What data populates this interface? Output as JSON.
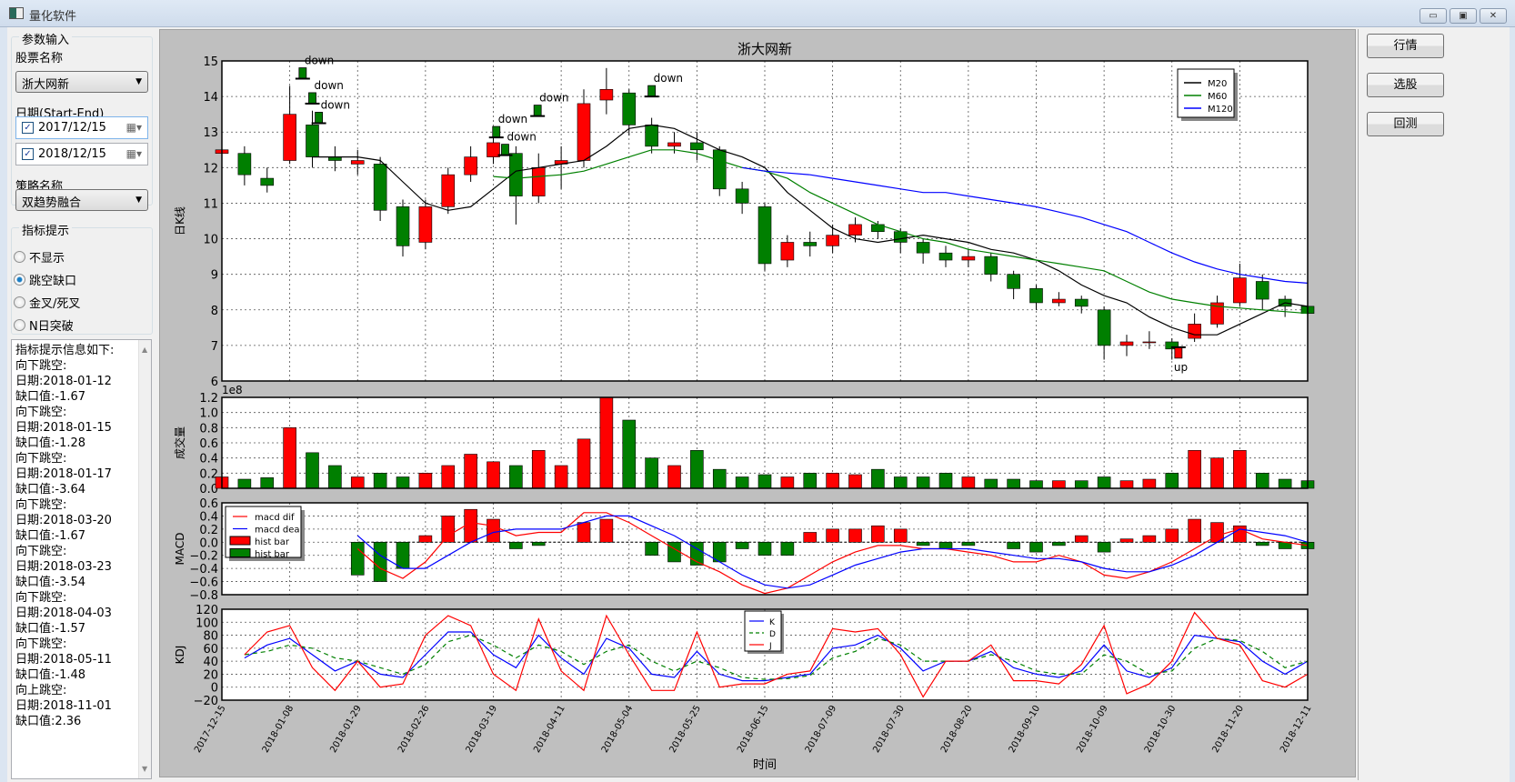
{
  "window": {
    "title": "量化软件",
    "minimize": "▭",
    "maximize": "▣",
    "close": "✕"
  },
  "left": {
    "params_group": "参数输入",
    "stock_label": "股票名称",
    "stock_value": "浙大网新",
    "date_label": "日期(Start-End)",
    "start_date": "2017/12/15",
    "end_date": "2018/12/15",
    "strategy_label": "策略名称",
    "strategy_value": "双趋势融合",
    "indicator_group": "指标提示",
    "radios": [
      {
        "label": "不显示",
        "checked": false
      },
      {
        "label": "跳空缺口",
        "checked": true
      },
      {
        "label": "金叉/死叉",
        "checked": false
      },
      {
        "label": "N日突破",
        "checked": false
      }
    ],
    "info_lines": [
      "指标提示信息如下:",
      "向下跳空:",
      "日期:2018-01-12",
      "缺口值:-1.67",
      "向下跳空:",
      "日期:2018-01-15",
      "缺口值:-1.28",
      "向下跳空:",
      "日期:2018-01-17",
      "缺口值:-3.64",
      "向下跳空:",
      "日期:2018-03-20",
      "缺口值:-1.67",
      "向下跳空:",
      "日期:2018-03-23",
      "缺口值:-3.54",
      "向下跳空:",
      "日期:2018-04-03",
      "缺口值:-1.57",
      "向下跳空:",
      "日期:2018-05-11",
      "缺口值:-1.48",
      "向上跳空:",
      "日期:2018-11-01",
      "缺口值:2.36"
    ]
  },
  "right": {
    "buttons": [
      "行情",
      "选股",
      "回测"
    ]
  },
  "colors": {
    "up": "#ff0000",
    "down": "#007f00",
    "m20": "#000000",
    "m60": "#008000",
    "m120": "#0000ff",
    "dif": "#ff0000",
    "dea": "#0000ff",
    "k": "#0000ff",
    "d": "#008000",
    "j": "#ff0000"
  },
  "chart_data": {
    "type": "candlestick",
    "title": "浙大网新",
    "xlabel": "时间",
    "x_ticks": [
      "2017-12-15",
      "2018-01-08",
      "2018-01-29",
      "2018-02-26",
      "2018-03-19",
      "2018-04-11",
      "2018-05-04",
      "2018-05-25",
      "2018-06-15",
      "2018-07-09",
      "2018-07-30",
      "2018-08-20",
      "2018-09-10",
      "2018-10-09",
      "2018-10-30",
      "2018-11-20",
      "2018-12-11"
    ],
    "dates": [
      "2017-12-15",
      "2017-12-23",
      "2018-01-02",
      "2018-01-08",
      "2018-01-15",
      "2018-01-22",
      "2018-01-29",
      "2018-02-07",
      "2018-02-16",
      "2018-02-26",
      "2018-03-05",
      "2018-03-12",
      "2018-03-19",
      "2018-03-27",
      "2018-04-03",
      "2018-04-11",
      "2018-04-18",
      "2018-04-26",
      "2018-05-04",
      "2018-05-11",
      "2018-05-18",
      "2018-05-25",
      "2018-06-01",
      "2018-06-08",
      "2018-06-15",
      "2018-06-23",
      "2018-07-01",
      "2018-07-09",
      "2018-07-16",
      "2018-07-23",
      "2018-07-30",
      "2018-08-06",
      "2018-08-13",
      "2018-08-20",
      "2018-08-27",
      "2018-09-03",
      "2018-09-10",
      "2018-09-19",
      "2018-09-29",
      "2018-10-09",
      "2018-10-16",
      "2018-10-23",
      "2018-10-30",
      "2018-11-06",
      "2018-11-13",
      "2018-11-20",
      "2018-11-27",
      "2018-12-04",
      "2018-12-11"
    ],
    "price": {
      "ylabel": "日K线",
      "ylim": [
        6,
        15
      ],
      "grid": true,
      "open": [
        12.4,
        12.4,
        11.7,
        12.2,
        13.2,
        12.3,
        12.1,
        12.1,
        10.9,
        9.9,
        10.9,
        11.8,
        12.3,
        12.4,
        11.2,
        12.1,
        12.2,
        13.9,
        14.1,
        13.2,
        12.6,
        12.7,
        12.5,
        11.4,
        10.9,
        9.4,
        9.9,
        9.8,
        10.1,
        10.4,
        10.2,
        9.9,
        9.6,
        9.4,
        9.5,
        9.0,
        8.6,
        8.2,
        8.3,
        8.0,
        7.0,
        7.1,
        7.1,
        7.2,
        7.6,
        8.2,
        8.8,
        8.3,
        8.1
      ],
      "close": [
        12.5,
        11.8,
        11.5,
        13.5,
        12.3,
        12.2,
        12.2,
        10.8,
        9.8,
        10.9,
        11.8,
        12.3,
        12.7,
        11.2,
        12.0,
        12.2,
        13.8,
        14.2,
        13.2,
        12.6,
        12.7,
        12.5,
        11.4,
        11.0,
        9.3,
        9.9,
        9.8,
        10.1,
        10.4,
        10.2,
        9.9,
        9.6,
        9.4,
        9.5,
        9.0,
        8.6,
        8.2,
        8.3,
        8.1,
        7.0,
        7.1,
        7.1,
        6.9,
        7.6,
        8.2,
        8.9,
        8.3,
        8.1,
        7.9
      ],
      "high": [
        12.8,
        12.6,
        12.0,
        14.3,
        13.6,
        12.6,
        12.5,
        12.3,
        11.1,
        11.1,
        12.0,
        12.6,
        13.0,
        12.6,
        12.4,
        12.6,
        14.2,
        14.8,
        14.2,
        13.4,
        13.0,
        13.0,
        12.6,
        11.6,
        11.0,
        10.1,
        10.2,
        10.4,
        10.6,
        10.5,
        10.3,
        10.0,
        9.8,
        9.7,
        9.6,
        9.1,
        8.7,
        8.5,
        8.4,
        8.1,
        7.3,
        7.4,
        7.2,
        7.9,
        8.4,
        9.3,
        9.0,
        8.4,
        8.2
      ],
      "low": [
        12.2,
        11.5,
        11.3,
        12.1,
        12.0,
        11.9,
        11.8,
        10.5,
        9.5,
        9.7,
        10.7,
        11.6,
        12.1,
        10.4,
        11.0,
        11.4,
        12.0,
        13.5,
        12.9,
        12.4,
        12.4,
        12.2,
        11.2,
        10.7,
        9.1,
        9.2,
        9.5,
        9.6,
        9.9,
        10.0,
        9.6,
        9.3,
        9.2,
        9.2,
        8.8,
        8.3,
        8.0,
        8.1,
        7.9,
        6.6,
        6.7,
        6.9,
        6.6,
        7.1,
        7.5,
        8.1,
        8.0,
        7.8,
        7.7
      ],
      "series": [
        {
          "name": "M20",
          "values": [
            null,
            null,
            null,
            null,
            12.3,
            12.3,
            12.3,
            12.2,
            11.6,
            11.0,
            10.8,
            10.9,
            11.4,
            11.9,
            12.0,
            12.1,
            12.2,
            12.6,
            13.1,
            13.2,
            13.1,
            12.8,
            12.5,
            12.3,
            12.0,
            11.3,
            10.8,
            10.3,
            10.0,
            9.9,
            10.0,
            10.1,
            10.0,
            9.9,
            9.7,
            9.6,
            9.4,
            9.1,
            8.7,
            8.4,
            8.2,
            7.8,
            7.5,
            7.3,
            7.3,
            7.6,
            7.9,
            8.2,
            8.1
          ]
        },
        {
          "name": "M60",
          "values": [
            null,
            null,
            null,
            null,
            null,
            null,
            null,
            null,
            null,
            null,
            null,
            null,
            11.75,
            11.7,
            11.75,
            11.8,
            11.9,
            12.1,
            12.3,
            12.5,
            12.5,
            12.4,
            12.2,
            12.0,
            11.9,
            11.7,
            11.3,
            11.0,
            10.7,
            10.4,
            10.2,
            10.0,
            9.9,
            9.7,
            9.6,
            9.5,
            9.4,
            9.3,
            9.2,
            9.1,
            8.8,
            8.5,
            8.3,
            8.2,
            8.1,
            8.05,
            8.0,
            7.95,
            7.9
          ]
        },
        {
          "name": "M120",
          "values": [
            null,
            null,
            null,
            null,
            null,
            null,
            null,
            null,
            null,
            null,
            null,
            null,
            null,
            null,
            null,
            null,
            null,
            null,
            null,
            null,
            null,
            null,
            null,
            12.0,
            11.9,
            11.85,
            11.8,
            11.7,
            11.6,
            11.5,
            11.4,
            11.3,
            11.3,
            11.2,
            11.1,
            11.0,
            10.9,
            10.75,
            10.6,
            10.4,
            10.2,
            9.9,
            9.6,
            9.35,
            9.15,
            9.0,
            8.9,
            8.8,
            8.75
          ]
        }
      ],
      "legend": "top-right",
      "annotations": [
        {
          "text": "down",
          "date": "2018-01-12",
          "y": 14.5
        },
        {
          "text": "down",
          "date": "2018-01-15",
          "y": 13.8
        },
        {
          "text": "down",
          "date": "2018-01-17",
          "y": 13.25
        },
        {
          "text": "down",
          "date": "2018-03-20",
          "y": 12.85
        },
        {
          "text": "down",
          "date": "2018-03-23",
          "y": 12.35
        },
        {
          "text": "down",
          "date": "2018-04-03",
          "y": 13.45
        },
        {
          "text": "down",
          "date": "2018-05-11",
          "y": 14.0
        },
        {
          "text": "up",
          "date": "2018-11-01",
          "y": 6.95
        }
      ]
    },
    "volume": {
      "ylabel": "成交量",
      "offset_text": "1e8",
      "ylim": [
        0,
        1.2
      ],
      "grid": true,
      "values": [
        0.15,
        0.12,
        0.14,
        0.8,
        0.47,
        0.3,
        0.15,
        0.2,
        0.15,
        0.2,
        0.3,
        0.45,
        0.35,
        0.3,
        0.5,
        0.3,
        0.65,
        1.2,
        0.9,
        0.4,
        0.3,
        0.5,
        0.25,
        0.15,
        0.18,
        0.15,
        0.2,
        0.2,
        0.18,
        0.25,
        0.15,
        0.15,
        0.2,
        0.15,
        0.12,
        0.12,
        0.1,
        0.1,
        0.1,
        0.15,
        0.1,
        0.12,
        0.2,
        0.5,
        0.4,
        0.5,
        0.2,
        0.12,
        0.1
      ]
    },
    "macd": {
      "ylabel": "MACD",
      "ylim": [
        -0.8,
        0.6
      ],
      "grid": true,
      "legend": "top-left",
      "legend_labels": [
        "macd dif",
        "macd dea",
        "hist bar",
        "hist bar"
      ],
      "dif": [
        null,
        null,
        null,
        null,
        null,
        null,
        -0.1,
        -0.4,
        -0.55,
        -0.3,
        0.1,
        0.3,
        0.25,
        0.1,
        0.15,
        0.15,
        0.45,
        0.45,
        0.3,
        0.1,
        -0.1,
        -0.3,
        -0.45,
        -0.65,
        -0.78,
        -0.7,
        -0.5,
        -0.3,
        -0.15,
        -0.05,
        -0.05,
        -0.1,
        -0.1,
        -0.15,
        -0.2,
        -0.3,
        -0.3,
        -0.2,
        -0.3,
        -0.5,
        -0.55,
        -0.45,
        -0.3,
        -0.1,
        0.1,
        0.2,
        0.05,
        0.0,
        -0.05
      ],
      "dea": [
        null,
        null,
        null,
        null,
        null,
        null,
        0.1,
        -0.2,
        -0.4,
        -0.4,
        -0.2,
        0.0,
        0.15,
        0.2,
        0.2,
        0.2,
        0.3,
        0.4,
        0.4,
        0.25,
        0.1,
        -0.1,
        -0.3,
        -0.5,
        -0.65,
        -0.7,
        -0.65,
        -0.5,
        -0.35,
        -0.25,
        -0.15,
        -0.1,
        -0.1,
        -0.1,
        -0.15,
        -0.2,
        -0.25,
        -0.25,
        -0.3,
        -0.4,
        -0.45,
        -0.45,
        -0.35,
        -0.2,
        0.0,
        0.2,
        0.15,
        0.1,
        0.0
      ],
      "hist": [
        null,
        null,
        null,
        null,
        null,
        null,
        -0.5,
        -0.6,
        -0.4,
        0.1,
        0.4,
        0.5,
        0.35,
        -0.1,
        -0.05,
        0.0,
        0.3,
        0.35,
        0.0,
        -0.2,
        -0.3,
        -0.35,
        -0.3,
        -0.1,
        -0.2,
        -0.2,
        0.15,
        0.2,
        0.2,
        0.25,
        0.2,
        -0.05,
        -0.1,
        -0.05,
        0.0,
        -0.1,
        -0.15,
        -0.05,
        0.1,
        -0.15,
        0.05,
        0.1,
        0.2,
        0.35,
        0.3,
        0.25,
        -0.05,
        -0.1,
        -0.1
      ]
    },
    "kdj": {
      "ylabel": "KDJ",
      "ylim": [
        -20,
        120
      ],
      "grid": true,
      "legend": "top-center",
      "legend_labels": [
        "K",
        "D",
        "J"
      ],
      "K": [
        null,
        45,
        65,
        75,
        50,
        25,
        40,
        20,
        15,
        50,
        85,
        85,
        50,
        30,
        80,
        45,
        20,
        75,
        60,
        20,
        15,
        55,
        20,
        10,
        10,
        15,
        20,
        60,
        65,
        80,
        60,
        25,
        40,
        40,
        55,
        30,
        20,
        15,
        25,
        65,
        25,
        15,
        30,
        80,
        75,
        70,
        40,
        20,
        40
      ],
      "D": [
        null,
        50,
        55,
        65,
        60,
        45,
        40,
        30,
        20,
        35,
        70,
        80,
        65,
        45,
        65,
        55,
        35,
        55,
        65,
        40,
        25,
        40,
        30,
        15,
        12,
        13,
        18,
        45,
        55,
        75,
        65,
        40,
        40,
        40,
        50,
        40,
        25,
        20,
        20,
        50,
        40,
        20,
        25,
        60,
        75,
        72,
        55,
        30,
        40
      ],
      "J": [
        null,
        50,
        85,
        95,
        30,
        -5,
        40,
        0,
        5,
        80,
        110,
        95,
        20,
        -5,
        105,
        25,
        -5,
        110,
        50,
        -5,
        -5,
        85,
        0,
        5,
        5,
        20,
        25,
        90,
        85,
        90,
        50,
        -15,
        40,
        40,
        65,
        10,
        10,
        5,
        35,
        95,
        -10,
        5,
        40,
        115,
        75,
        65,
        10,
        0,
        20
      ]
    }
  }
}
